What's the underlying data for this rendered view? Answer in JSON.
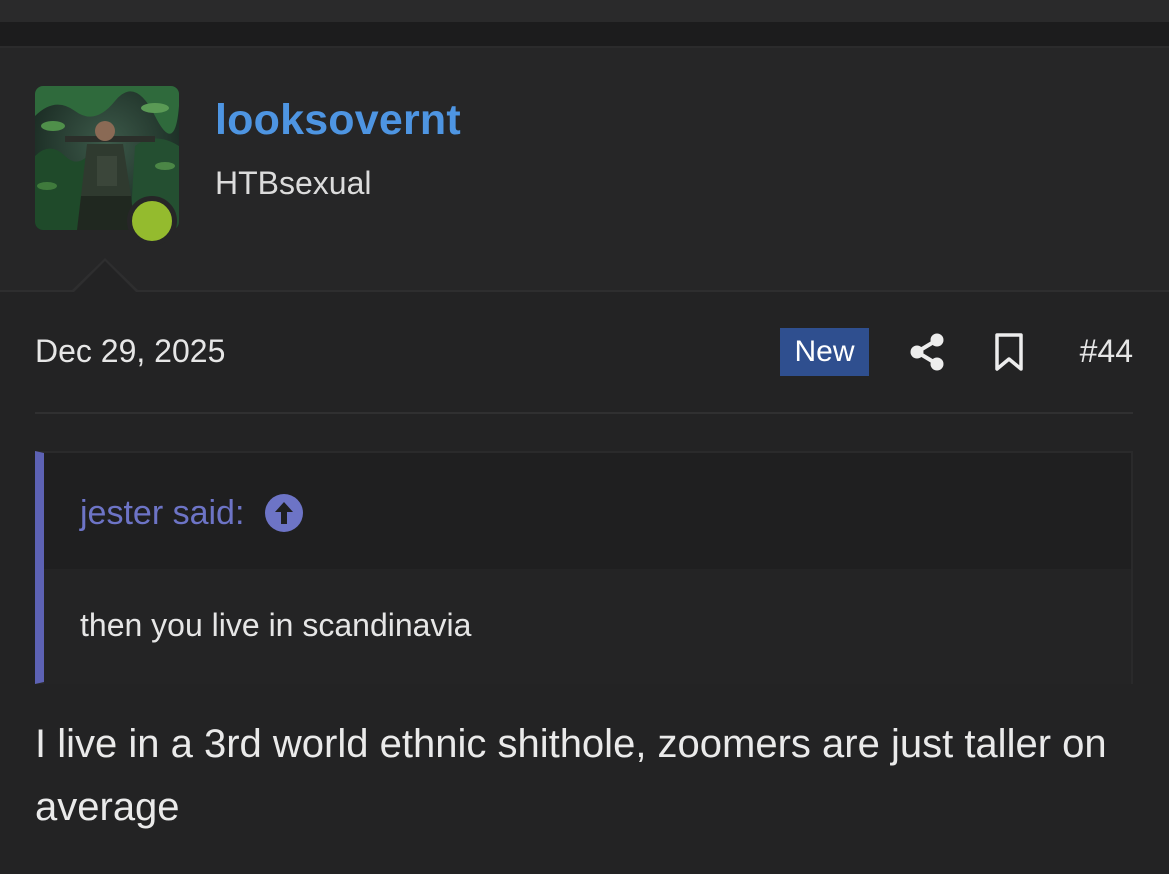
{
  "post": {
    "username": "looksovernt",
    "user_title": "HTBsexual",
    "online_status": "online",
    "date": "Dec 29, 2025",
    "new_badge": "New",
    "post_number": "#44",
    "actions": {
      "share": "share-icon",
      "bookmark": "bookmark-icon"
    },
    "quote": {
      "author": "jester said:",
      "jump_icon": "arrow-up-circle-icon",
      "text": "then you live in scandinavia"
    },
    "message": "I live in a 3rd world ethnic shithole, zoomers are just taller on average"
  },
  "colors": {
    "background": "#232324",
    "username": "#4e95e2",
    "online": "#94bb2e",
    "new_badge": "#2f4f8f",
    "quote_accent": "#5d62b4",
    "quote_author": "#6d74c6"
  }
}
